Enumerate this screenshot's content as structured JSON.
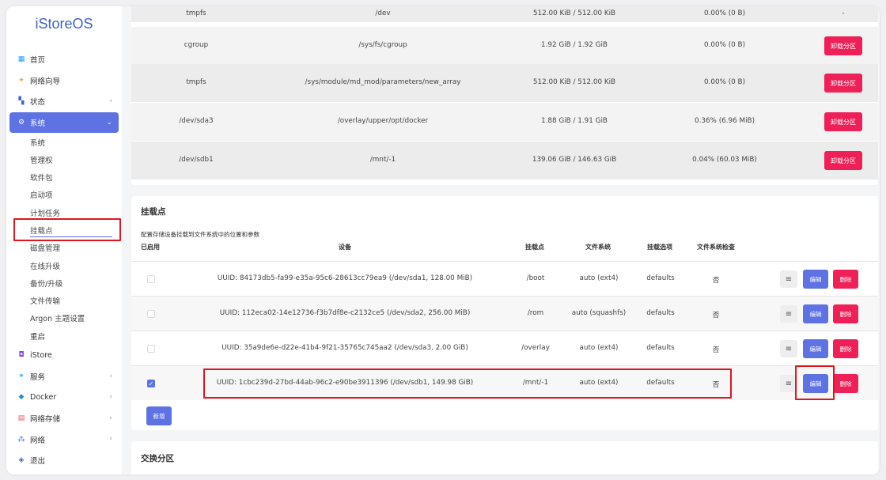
{
  "brand": "iStoreOS",
  "sidebar": {
    "items": [
      {
        "label": "首页",
        "icon": "dashboard-icon",
        "glyph": "▦",
        "color": "#1da1f2"
      },
      {
        "label": "网络向导",
        "icon": "wizard-icon",
        "glyph": "✦",
        "color": "#f5a623"
      },
      {
        "label": "状态",
        "icon": "status-icon",
        "glyph": "▚",
        "color": "#3f62c9",
        "chevron": "›"
      },
      {
        "label": "系统",
        "icon": "gear-icon",
        "glyph": "⚙",
        "color": "#ffffff",
        "chevron": "⌄",
        "active": true
      }
    ],
    "sub_items": [
      "系统",
      "管理权",
      "软件包",
      "启动项",
      "计划任务",
      "挂载点",
      "磁盘管理",
      "在线升级",
      "备份/升级",
      "文件传输",
      "Argon 主题设置",
      "重启"
    ],
    "bottom_items": [
      {
        "label": "iStore",
        "icon": "store-icon",
        "glyph": "◘",
        "color": "#8a4dd6"
      },
      {
        "label": "服务",
        "icon": "services-icon",
        "glyph": "⚭",
        "color": "#1da1f2",
        "chevron": "›"
      },
      {
        "label": "Docker",
        "icon": "docker-icon",
        "glyph": "◆",
        "color": "#1d8de0",
        "chevron": "›"
      },
      {
        "label": "网络存储",
        "icon": "storage-icon",
        "glyph": "▤",
        "color": "#e8555c",
        "chevron": "›"
      },
      {
        "label": "网络",
        "icon": "network-icon",
        "glyph": "⁂",
        "color": "#3f62c9",
        "chevron": "›"
      },
      {
        "label": "退出",
        "icon": "logout-icon",
        "glyph": "◈",
        "color": "#3f62c9"
      }
    ]
  },
  "mounted_fs": {
    "rows": [
      {
        "fs": "tmpfs",
        "mount": "/dev",
        "size": "512.00 KiB / 512.00 KiB",
        "used": "0.00% (0 B)",
        "action": "-"
      },
      {
        "fs": "cgroup",
        "mount": "/sys/fs/cgroup",
        "size": "1.92 GiB / 1.92 GiB",
        "used": "0.00% (0 B)",
        "action": "卸载分区"
      },
      {
        "fs": "tmpfs",
        "mount": "/sys/module/md_mod/parameters/new_array",
        "size": "512.00 KiB / 512.00 KiB",
        "used": "0.00% (0 B)",
        "action": "卸载分区"
      },
      {
        "fs": "/dev/sda3",
        "mount": "/overlay/upper/opt/docker",
        "size": "1.88 GiB / 1.91 GiB",
        "used": "0.36% (6.96 MiB)",
        "action": "卸载分区"
      },
      {
        "fs": "/dev/sdb1",
        "mount": "/mnt/-1",
        "size": "139.06 GiB / 146.63 GiB",
        "used": "0.04% (60.03 MiB)",
        "action": "卸载分区"
      }
    ]
  },
  "mount_points": {
    "title": "挂载点",
    "description": "配置存储设备挂载到文件系统中的位置和参数",
    "headers": {
      "enabled": "已启用",
      "device": "设备",
      "mountpoint": "挂载点",
      "filesystem": "文件系统",
      "options": "挂载选项",
      "fsck": "文件系统检查"
    },
    "rows": [
      {
        "checked": false,
        "device": "UUID: 84173db5-fa99-e35a-95c6-28613cc79ea9 (/dev/sda1, 128.00 MiB)",
        "mountpoint": "/boot",
        "filesystem": "auto (ext4)",
        "options": "defaults",
        "fsck": "否"
      },
      {
        "checked": false,
        "device": "UUID: 112eca02-14e12736-f3b7df8e-c2132ce5 (/dev/sda2, 256.00 MiB)",
        "mountpoint": "/rom",
        "filesystem": "auto (squashfs)",
        "options": "defaults",
        "fsck": "否"
      },
      {
        "checked": false,
        "device": "UUID: 35a9de6e-d22e-41b4-9f21-35765c745aa2 (/dev/sda3, 2.00 GiB)",
        "mountpoint": "/overlay",
        "filesystem": "auto (ext4)",
        "options": "defaults",
        "fsck": "否"
      },
      {
        "checked": true,
        "device": "UUID: 1cbc239d-27bd-44ab-96c2-e90be3911396 (/dev/sdb1, 149.98 GiB)",
        "mountpoint": "/mnt/-1",
        "filesystem": "auto (ext4)",
        "options": "defaults",
        "fsck": "否"
      }
    ],
    "menu_glyph": "≡",
    "edit_label": "编辑",
    "delete_label": "删除",
    "add_label": "新增"
  },
  "swap": {
    "title": "交换分区"
  },
  "colors": {
    "accent": "#5e72e4",
    "danger": "#ee2057",
    "highlight": "#e0151d"
  }
}
